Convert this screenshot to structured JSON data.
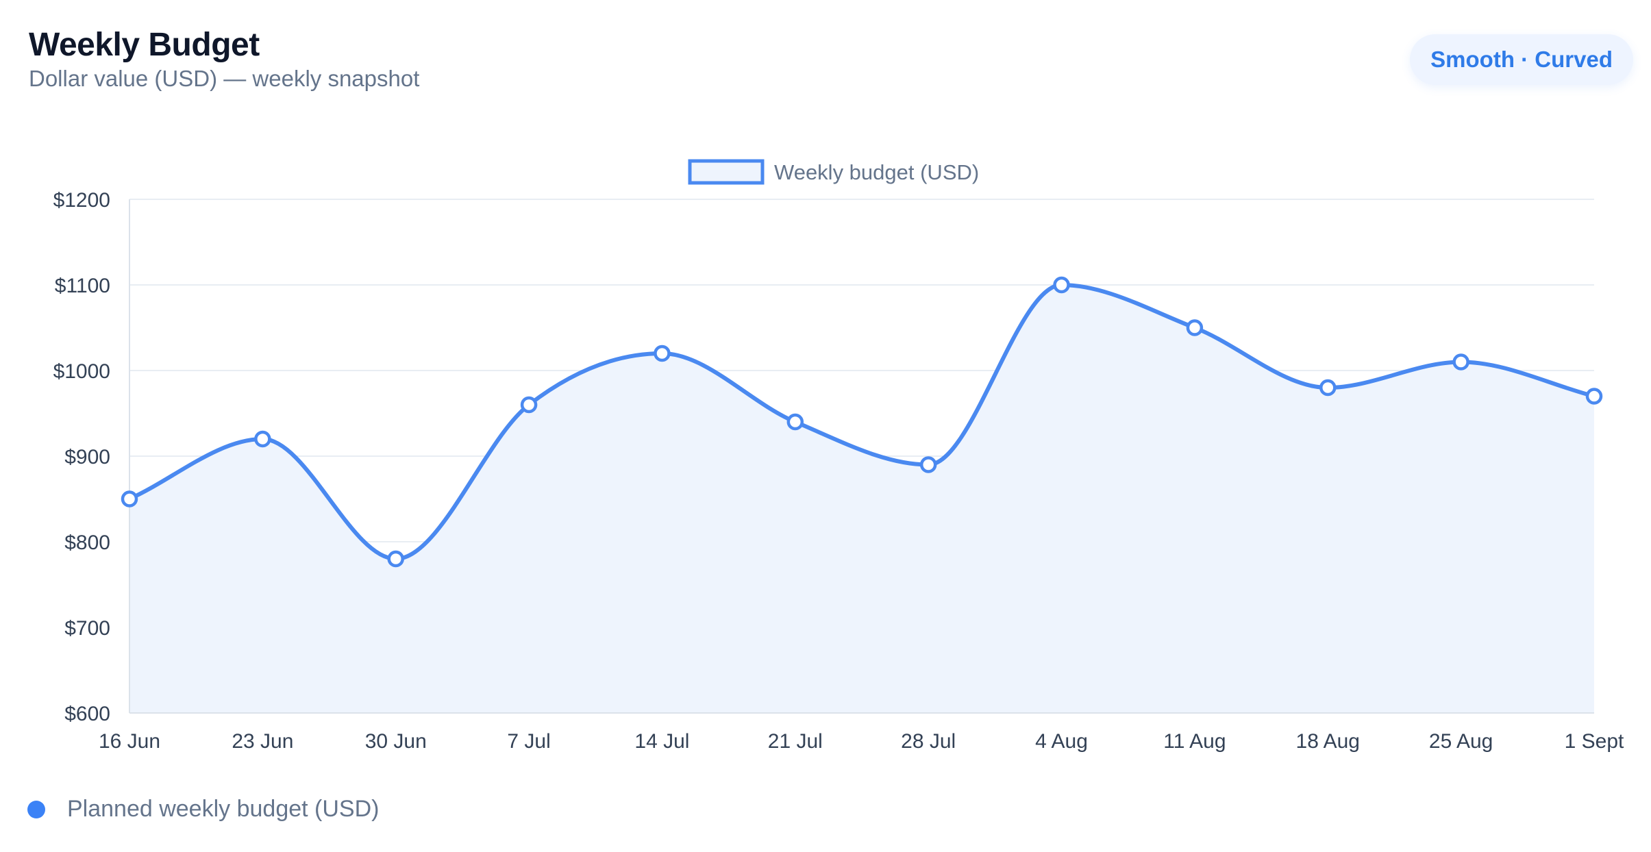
{
  "header": {
    "title": "Weekly Budget",
    "subtitle": "Dollar value (USD) — weekly snapshot",
    "mode_badge": "Smooth · Curved"
  },
  "footer": {
    "legend_label": "Planned weekly budget (USD)"
  },
  "colors": {
    "line": "#4a89f0",
    "fill": "#eef4fd",
    "grid": "#e8edf3",
    "axis_text": "#334155",
    "legend_text": "#64748b",
    "point_fill": "#ffffff"
  },
  "chart_data": {
    "type": "line",
    "smooth": true,
    "filled": true,
    "title": "",
    "xlabel": "",
    "ylabel": "",
    "legend": {
      "position": "top-center",
      "entries": [
        "Weekly budget (USD)"
      ]
    },
    "grid": true,
    "x": [
      "16 Jun",
      "23 Jun",
      "30 Jun",
      "7 Jul",
      "14 Jul",
      "21 Jul",
      "28 Jul",
      "4 Aug",
      "11 Aug",
      "18 Aug",
      "25 Aug",
      "1 Sept"
    ],
    "series": [
      {
        "name": "Weekly budget (USD)",
        "values": [
          850,
          920,
          780,
          960,
          1020,
          940,
          890,
          1100,
          1050,
          980,
          1010,
          970
        ]
      }
    ],
    "ylim": [
      600,
      1200
    ],
    "yticks": [
      600,
      700,
      800,
      900,
      1000,
      1100,
      1200
    ],
    "ytick_labels": [
      "$600",
      "$700",
      "$800",
      "$900",
      "$1000",
      "$1100",
      "$1200"
    ]
  }
}
